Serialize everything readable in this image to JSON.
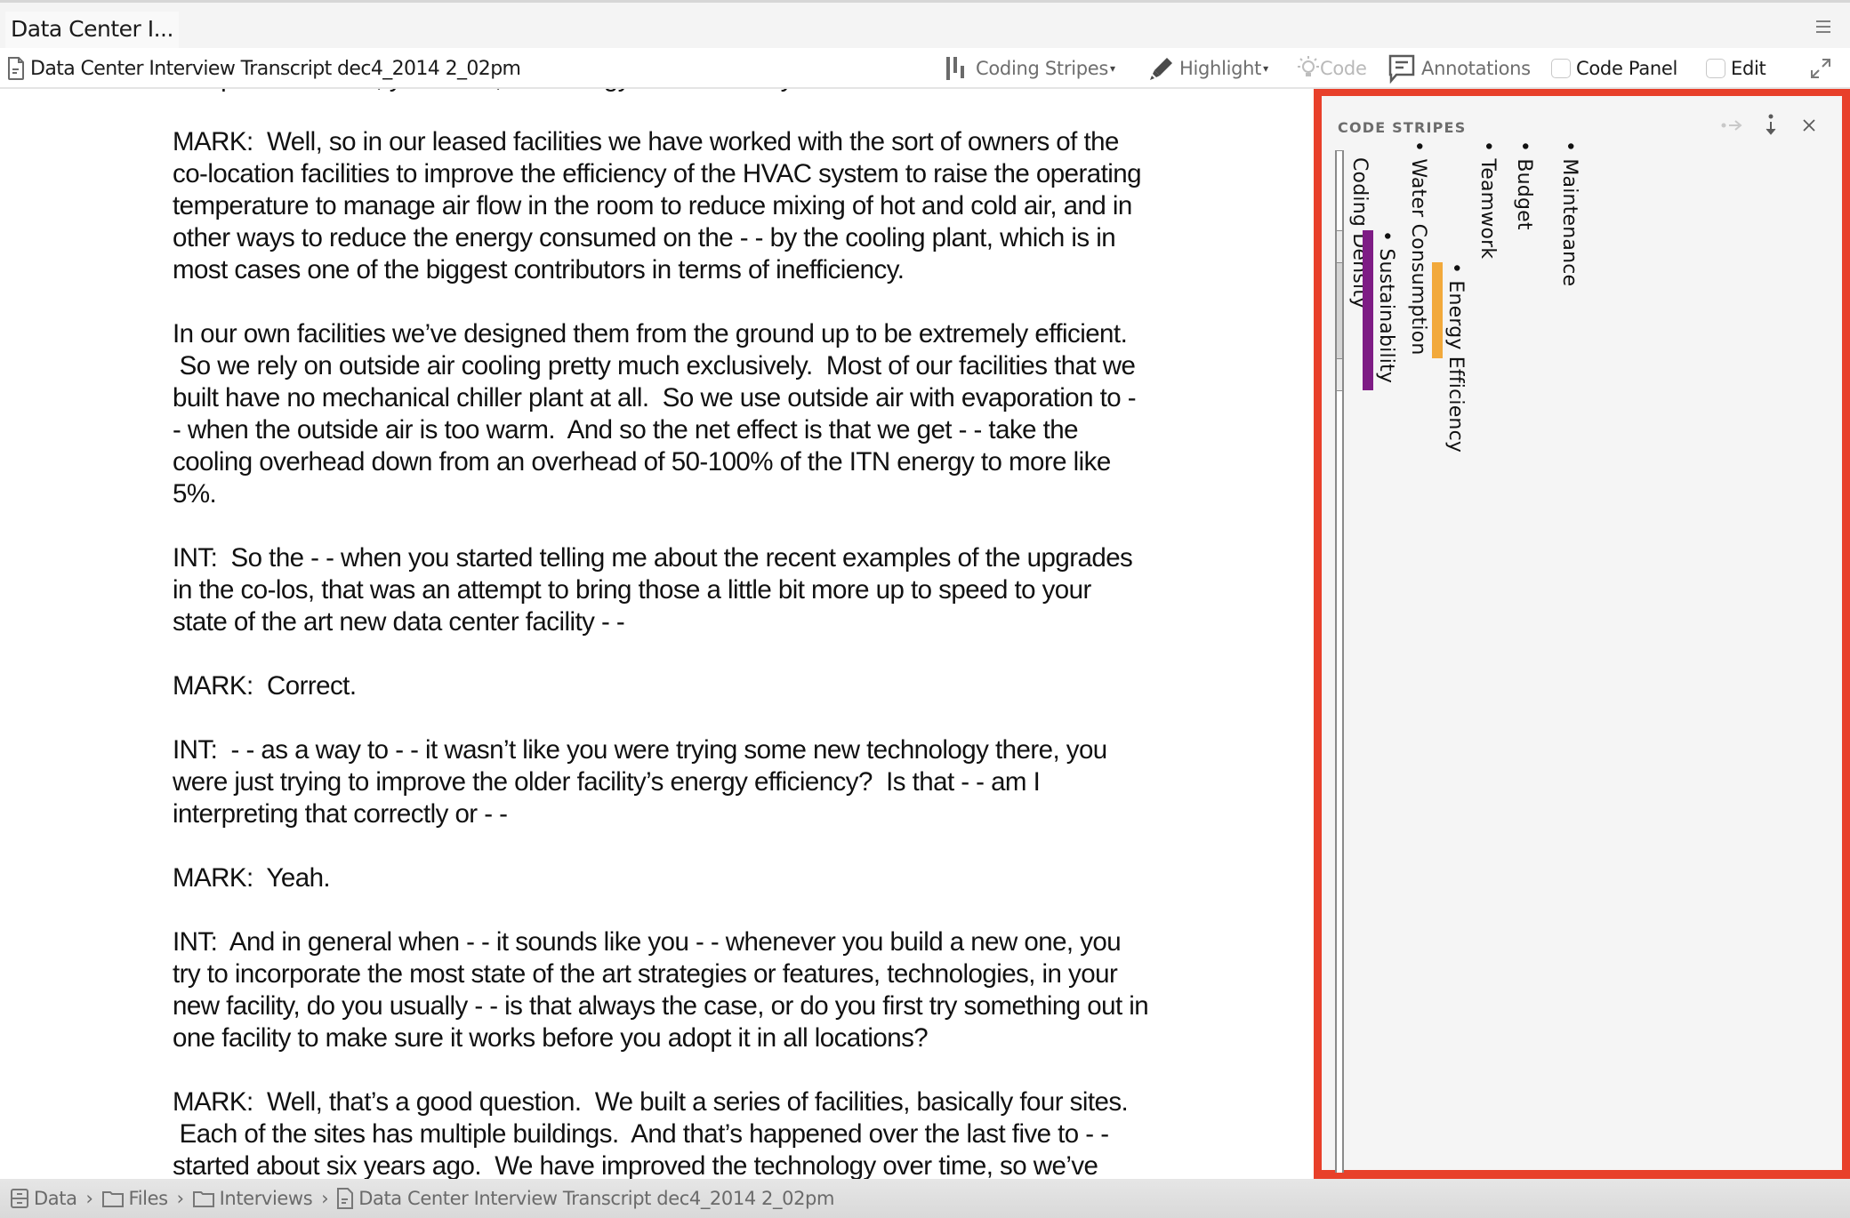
{
  "tab": {
    "title": "Data Center I..."
  },
  "toolbar": {
    "doc_title": "Data Center Interview Transcript dec4_2014 2_02pm",
    "coding_stripes_label": "Coding Stripes",
    "highlight_label": "Highlight",
    "code_label": "Code",
    "annotations_label": "Annotations",
    "code_panel_label": "Code Panel",
    "code_panel_checked": false,
    "edit_label": "Edit",
    "edit_checked": false,
    "caret": "▾"
  },
  "document": {
    "paragraphs": [
      {
        "lines": [
          "compared to other, you know, technology in the industry?"
        ]
      },
      {
        "lines": [
          "MARK:  Well, so in our leased facilities we have worked with the sort of owners of the",
          "co-location facilities to improve the efficiency of the HVAC system to raise the operating",
          "temperature to manage air flow in the room to reduce mixing of hot and cold air, and in",
          "other ways to reduce the energy consumed on the - - by the cooling plant, which is in",
          "most cases one of the biggest contributors in terms of inefficiency."
        ]
      },
      {
        "lines": [
          "In our own facilities we’ve designed them from the ground up to be extremely efficient.",
          " So we rely on outside air cooling pretty much exclusively.  Most of our facilities that we",
          "built have no mechanical chiller plant at all.  So we use outside air with evaporation to -",
          "- when the outside air is too warm.  And so the net effect is that we get - - take the",
          "cooling overhead down from an overhead of 50-100% of the ITN energy to more like",
          "5%."
        ]
      },
      {
        "lines": [
          "INT:  So the - - when you started telling me about the recent examples of the upgrades",
          "in the co-los, that was an attempt to bring those a little bit more up to speed to your",
          "state of the art new data center facility - -"
        ]
      },
      {
        "lines": [
          "MARK:  Correct."
        ]
      },
      {
        "lines": [
          "INT:  - - as a way to - - it wasn’t like you were trying some new technology there, you",
          "were just trying to improve the older facility’s energy efficiency?  Is that - - am I",
          "interpreting that correctly or - -"
        ]
      },
      {
        "lines": [
          "MARK:  Yeah."
        ]
      },
      {
        "lines": [
          "INT:  And in general when - - it sounds like you - - whenever you build a new one, you",
          "try to incorporate the most state of the art strategies or features, technologies, in your",
          "new facility, do you usually - - is that always the case, or do you first try something out in",
          "one facility to make sure it works before you adopt it in all locations?"
        ]
      },
      {
        "lines": [
          "MARK:  Well, that’s a good question.  We built a series of facilities, basically four sites.",
          " Each of the sites has multiple buildings.  And that’s happened over the last five to - -",
          "started about six years ago.  We have improved the technology over time, so we’ve"
        ]
      }
    ]
  },
  "code_stripes_panel": {
    "title": "CODE STRIPES",
    "density_label": "Coding Density",
    "density_levels": [
      {
        "from_line": 0,
        "to_line": 5,
        "level": "none",
        "color": "#ffffff"
      },
      {
        "from_line": 5,
        "to_line": 7,
        "level": "low",
        "color": "#ebebeb"
      },
      {
        "from_line": 7,
        "to_line": 13,
        "level": "medium",
        "color": "#d5d5d5"
      },
      {
        "from_line": 13,
        "to_line": 15,
        "level": "low",
        "color": "#ebebeb"
      },
      {
        "from_line": 15,
        "to_line": 40,
        "level": "none",
        "color": "#ffffff"
      }
    ],
    "codes": [
      {
        "name": "• Sustainability",
        "color": "#7e1c85",
        "has_stripe": true
      },
      {
        "name": "• Water Consumption",
        "color": null,
        "has_stripe": false
      },
      {
        "name": "• Energy Efficiency",
        "color": "#f2a93b",
        "has_stripe": true
      },
      {
        "name": "• Teamwork",
        "color": null,
        "has_stripe": false
      },
      {
        "name": "• Budget",
        "color": null,
        "has_stripe": false
      },
      {
        "name": "• Maintenance",
        "color": null,
        "has_stripe": false
      }
    ],
    "highlight_border_color": "#e8402a"
  },
  "breadcrumb": {
    "items": [
      {
        "label": "Data",
        "icon": "cabinet-icon"
      },
      {
        "label": "Files",
        "icon": "folder-icon"
      },
      {
        "label": "Interviews",
        "icon": "folder-icon"
      },
      {
        "label": "Data Center Interview Transcript dec4_2014 2_02pm",
        "icon": "document-icon"
      }
    ],
    "separator": "›"
  }
}
